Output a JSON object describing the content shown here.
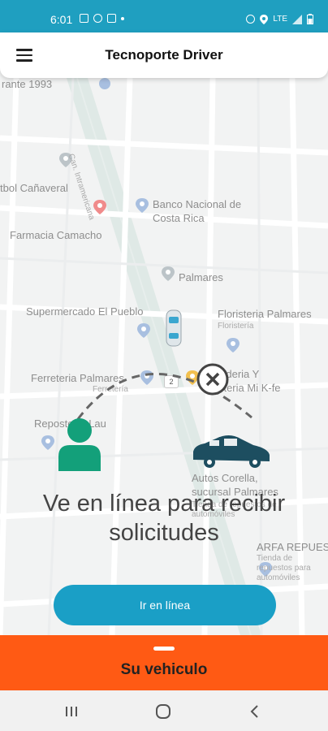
{
  "status_bar": {
    "time": "6:01",
    "network": "LTE",
    "icons": [
      "image-icon",
      "messenger-icon",
      "chat-icon",
      "dot-icon",
      "alarm-icon",
      "location-icon",
      "signal-icon",
      "battery-icon"
    ]
  },
  "header": {
    "title": "Tecnoporte Driver",
    "menu_icon": "hamburger-menu-icon"
  },
  "map": {
    "labels": [
      "rante 1993",
      "Can. Intramericana",
      "tbol Cañaveral",
      "Banco Nacional de Costa Rica",
      "Farmacia Camacho",
      "Palmares",
      "Supermercado El Pueblo",
      "Floristeria Palmares",
      "Floristería",
      "Ferreteria Palmares",
      "Ferretería",
      "Panaderia Y Cafeteria Mi K-fe",
      "Repostería Lau",
      "Autos Corella, sucursal Palmares",
      "Tienda de repuestos de automóviles",
      "ARFA REPUESTOS",
      "Tienda de repuestos para automóviles"
    ],
    "road_number": "2"
  },
  "prompt": {
    "message": "Ve en línea para recibir solicitudes",
    "go_online_label": "Ir en línea"
  },
  "bottom_sheet": {
    "title": "Su vehiculo"
  },
  "colors": {
    "status_bar": "#1f9fc0",
    "primary_button": "#1a9fc6",
    "sheet": "#ff5a14",
    "driver_icon": "#13a07a",
    "car_icon": "#1d4e60"
  }
}
